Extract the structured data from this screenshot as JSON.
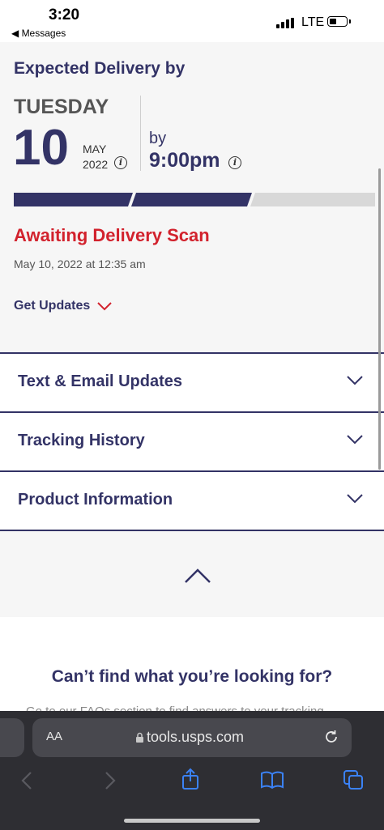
{
  "status_bar": {
    "time": "3:20",
    "back_app": "◀ Messages",
    "network": "LTE"
  },
  "delivery": {
    "heading": "Expected Delivery by",
    "weekday": "TUESDAY",
    "day": "10",
    "month": "MAY",
    "year": "2022",
    "by_label": "by",
    "by_time": "9:00pm",
    "progress_steps_complete": 2,
    "progress_steps_total": 3,
    "progress_color": "#333366",
    "status": "Awaiting Delivery Scan",
    "status_color": "#d2222d",
    "status_date": "May 10, 2022 at 12:35 am",
    "get_updates": "Get Updates"
  },
  "accordions": [
    {
      "label": "Text & Email Updates"
    },
    {
      "label": "Tracking History"
    },
    {
      "label": "Product Information"
    }
  ],
  "help": {
    "title": "Can’t find what you’re looking for?",
    "partial": "Go to our FAQs section to find answers to your tracking"
  },
  "browser": {
    "aa_label": "AA",
    "url": "tools.usps.com"
  }
}
